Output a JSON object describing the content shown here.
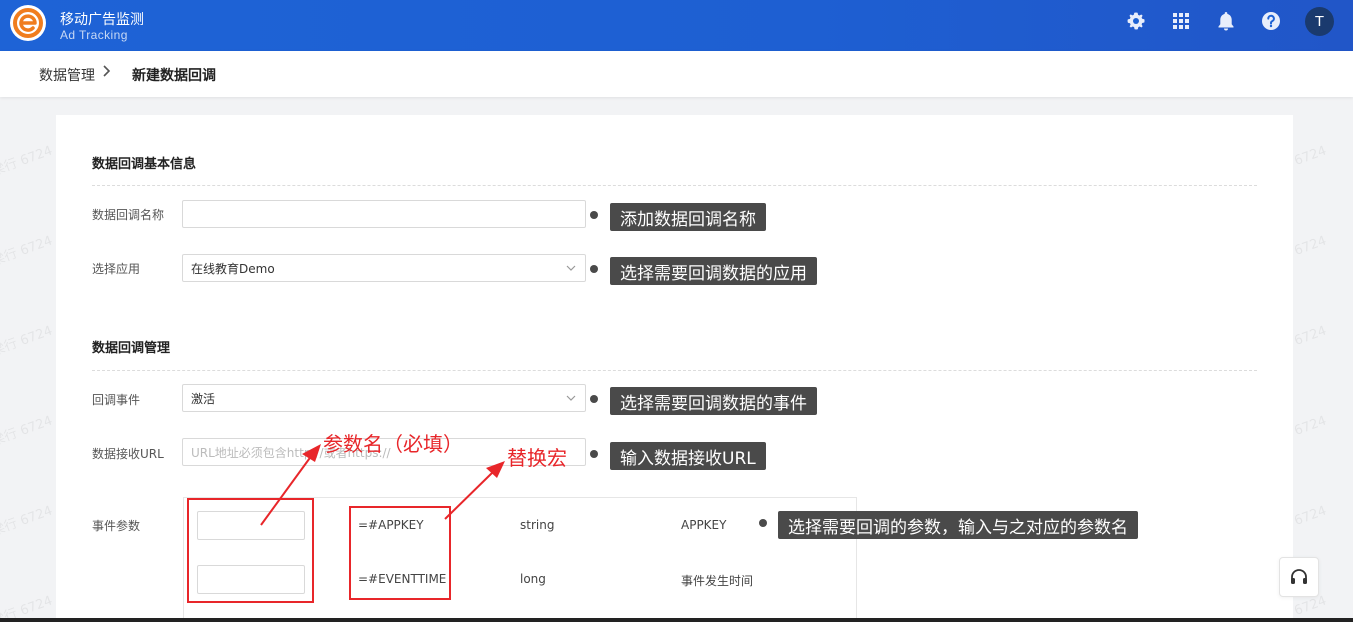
{
  "header": {
    "app_title": "移动广告监测",
    "app_subtitle": "Ad Tracking",
    "avatar_letter": "T",
    "icons": [
      "gear-icon",
      "apps-grid-icon",
      "bell-icon",
      "help-icon"
    ],
    "brand_color": "#1e63d6",
    "logo_color": "#f07d1e"
  },
  "breadcrumb": {
    "parent": "数据管理",
    "separator": ">",
    "current": "新建数据回调"
  },
  "form": {
    "basic_section_title": "数据回调基本信息",
    "name_label": "数据回调名称",
    "name_value": "",
    "app_label": "选择应用",
    "app_value": "在线教育Demo",
    "manage_section_title": "数据回调管理",
    "event_label": "回调事件",
    "event_value": "激活",
    "url_label": "数据接收URL",
    "url_placeholder": "URL地址必须包含http://或者https://",
    "params_label": "事件参数",
    "params": [
      {
        "macro": "=#APPKEY",
        "type": "string",
        "name": "APPKEY"
      },
      {
        "macro": "=#EVENTTIME",
        "type": "long",
        "name": "事件发生时间"
      }
    ]
  },
  "tooltips": {
    "name": "添加数据回调名称",
    "app": "选择需要回调数据的应用",
    "event": "选择需要回调数据的事件",
    "url": "输入数据接收URL",
    "params": "选择需要回调的参数，输入与之对应的参数名"
  },
  "annotations": {
    "param_name": "参数名（必填）",
    "macro": "替换宏",
    "color": "#e8262a"
  },
  "watermark_text": "梁行 6724"
}
